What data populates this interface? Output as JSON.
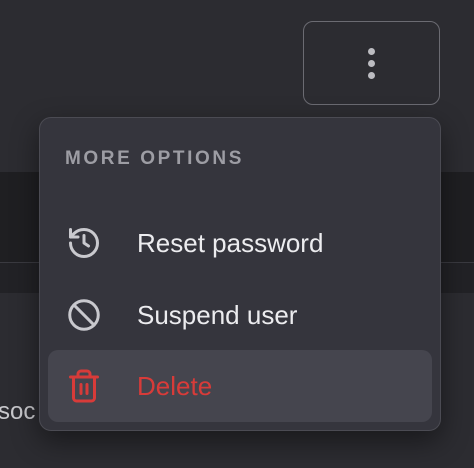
{
  "background": {
    "partial_text": "soc"
  },
  "kebab_button": {
    "icon": "more-vertical-icon"
  },
  "menu": {
    "heading": "MORE OPTIONS",
    "items": [
      {
        "label": "Reset password",
        "icon": "history-icon"
      },
      {
        "label": "Suspend user",
        "icon": "ban-icon"
      },
      {
        "label": "Delete",
        "icon": "trash-icon",
        "destructive": true,
        "highlighted": true
      }
    ]
  },
  "colors": {
    "page_background": "#2c2c31",
    "menu_background": "#35353d",
    "highlight_background": "#45454e",
    "danger": "#d83b39",
    "text": "#ececef",
    "muted": "#9d9da4"
  }
}
